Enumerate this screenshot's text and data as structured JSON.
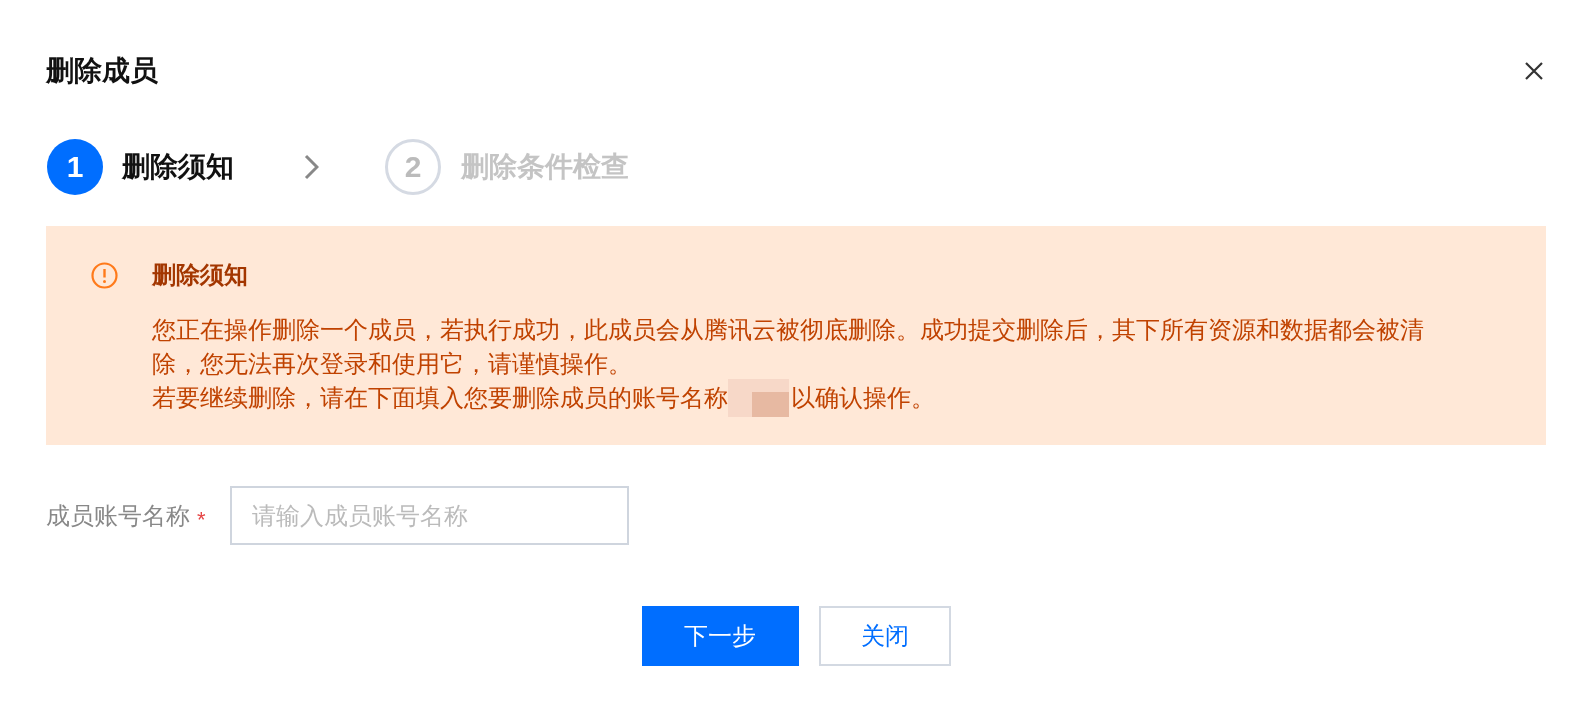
{
  "dialog": {
    "title": "删除成员"
  },
  "steps": [
    {
      "number": "1",
      "label": "删除须知",
      "current": true
    },
    {
      "number": "2",
      "label": "删除条件检查",
      "current": false
    }
  ],
  "notice": {
    "title": "删除须知",
    "paragraph": "您正在操作删除一个成员，若执行成功，此成员会从腾讯云被彻底删除。成功提交删除后，其下所有资源和数据都会被清除，您无法再次登录和使用它，请谨慎操作。",
    "confirm_before": "若要继续删除，请在下面填入您要删除成员的账号名称",
    "account_name_redacted": true,
    "confirm_after": "以确认操作。"
  },
  "form": {
    "label": "成员账号名称",
    "required_mark": "*",
    "placeholder": "请输入成员账号名称"
  },
  "buttons": [
    {
      "label": "下一步",
      "kind": "primary"
    },
    {
      "label": "关闭",
      "kind": "default"
    }
  ]
}
